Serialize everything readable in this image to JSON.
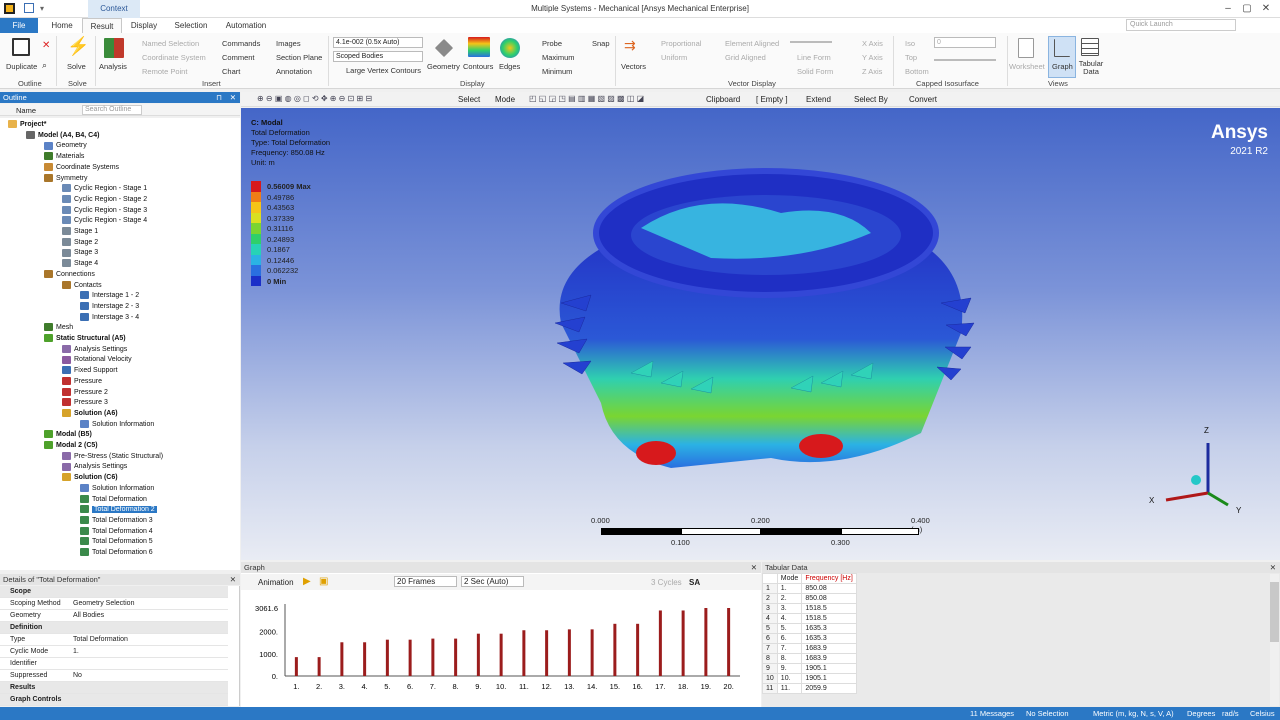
{
  "window": {
    "title": "Multiple Systems - Mechanical [Ansys Mechanical Enterprise]",
    "context_tab": "Context",
    "quick_launch": "Quick Launch"
  },
  "tabs": [
    "File",
    "Home",
    "Result",
    "Display",
    "Selection",
    "Automation"
  ],
  "ribbon": {
    "outline": {
      "duplicate": "Duplicate",
      "group": "Outline"
    },
    "solve": {
      "solve": "Solve",
      "group": "Solve"
    },
    "insert": {
      "analysis": "Analysis",
      "named_selection": "Named Selection",
      "coordinate_system": "Coordinate System",
      "remote_point": "Remote Point",
      "commands": "Commands",
      "comment": "Comment",
      "chart": "Chart",
      "images": "Images",
      "section_plane": "Section Plane",
      "annotation": "Annotation",
      "group": "Insert"
    },
    "display": {
      "scale": "4.1e-002 (0.5x Auto)",
      "scoped": "Scoped Bodies",
      "large_vertex": "Large Vertex Contours",
      "geometry": "Geometry",
      "contours": "Contours",
      "edges": "Edges",
      "probe": "Probe",
      "maximum": "Maximum",
      "minimum": "Minimum",
      "snap": "Snap",
      "group": "Display"
    },
    "vector": {
      "vectors": "Vectors",
      "proportional": "Proportional",
      "uniform": "Uniform",
      "element_aligned": "Element Aligned",
      "grid_aligned": "Grid Aligned",
      "line_form": "Line Form",
      "solid_form": "Solid Form",
      "x_axis": "X Axis",
      "y_axis": "Y Axis",
      "z_axis": "Z Axis",
      "group": "Vector Display"
    },
    "capped": {
      "iso": "Iso",
      "top": "Top",
      "bottom": "Bottom",
      "value": "0",
      "group": "Capped Isosurface"
    },
    "views": {
      "worksheet": "Worksheet",
      "graph": "Graph",
      "tabular": "Tabular Data",
      "group": "Views"
    }
  },
  "toolbar": {
    "select": "Select",
    "mode": "Mode",
    "clipboard": "Clipboard",
    "empty": "[ Empty ]",
    "extend": "Extend",
    "select_by": "Select By",
    "convert": "Convert"
  },
  "outline": {
    "title": "Outline",
    "name_col": "Name",
    "search_placeholder": "Search Outline",
    "nodes": [
      {
        "label": "Project*",
        "bold": true
      },
      {
        "label": "Model (A4, B4, C4)",
        "bold": true
      },
      {
        "label": "Geometry"
      },
      {
        "label": "Materials"
      },
      {
        "label": "Coordinate Systems"
      },
      {
        "label": "Symmetry"
      },
      {
        "label": "Cyclic Region - Stage 1"
      },
      {
        "label": "Cyclic Region - Stage 2"
      },
      {
        "label": "Cyclic Region - Stage 3"
      },
      {
        "label": "Cyclic Region - Stage 4"
      },
      {
        "label": "Stage 1"
      },
      {
        "label": "Stage 2"
      },
      {
        "label": "Stage 3"
      },
      {
        "label": "Stage 4"
      },
      {
        "label": "Connections"
      },
      {
        "label": "Contacts"
      },
      {
        "label": "Interstage 1 - 2"
      },
      {
        "label": "Interstage 2 - 3"
      },
      {
        "label": "Interstage 3 - 4"
      },
      {
        "label": "Mesh"
      },
      {
        "label": "Static Structural (A5)",
        "bold": true
      },
      {
        "label": "Analysis Settings"
      },
      {
        "label": "Rotational Velocity"
      },
      {
        "label": "Fixed Support"
      },
      {
        "label": "Pressure"
      },
      {
        "label": "Pressure 2"
      },
      {
        "label": "Pressure 3"
      },
      {
        "label": "Solution (A6)",
        "bold": true
      },
      {
        "label": "Solution Information"
      },
      {
        "label": "Modal (B5)",
        "bold": true
      },
      {
        "label": "Modal 2 (C5)",
        "bold": true
      },
      {
        "label": "Pre-Stress (Static Structural)"
      },
      {
        "label": "Analysis Settings"
      },
      {
        "label": "Solution (C6)",
        "bold": true
      },
      {
        "label": "Solution Information"
      },
      {
        "label": "Total Deformation"
      },
      {
        "label": "Total Deformation 2"
      },
      {
        "label": "Total Deformation 3"
      },
      {
        "label": "Total Deformation 4"
      },
      {
        "label": "Total Deformation 5"
      },
      {
        "label": "Total Deformation 6"
      }
    ]
  },
  "details": {
    "title": "Details of \"Total Deformation\"",
    "rows": [
      {
        "k": "Scope",
        "v": "",
        "sec": true
      },
      {
        "k": "Scoping Method",
        "v": "Geometry Selection"
      },
      {
        "k": "Geometry",
        "v": "All Bodies"
      },
      {
        "k": "Definition",
        "v": "",
        "sec": true
      },
      {
        "k": "Type",
        "v": "Total Deformation"
      },
      {
        "k": "Cyclic Mode",
        "v": "1."
      },
      {
        "k": "Identifier",
        "v": ""
      },
      {
        "k": "Suppressed",
        "v": "No"
      },
      {
        "k": "Results",
        "v": "",
        "sec": true
      },
      {
        "k": "Graph Controls",
        "v": "",
        "sec": true
      }
    ]
  },
  "viewport": {
    "info": [
      "C: Modal",
      "Total Deformation",
      "Type: Total Deformation",
      "Frequency: 850.08 Hz",
      "Unit: m"
    ],
    "brand": "Ansys",
    "version": "2021 R2",
    "legend": [
      "0.56009 Max",
      "0.49786",
      "0.43563",
      "0.37339",
      "0.31116",
      "0.24893",
      "0.1867",
      "0.12446",
      "0.062232",
      "0 Min"
    ],
    "legend_colors": [
      "#d7191c",
      "#f07d17",
      "#f5c518",
      "#d9e021",
      "#7ad531",
      "#2fd06a",
      "#27d3b6",
      "#2bb2e4",
      "#2a6fe0",
      "#1b2fc8"
    ],
    "scale_top": [
      "0.000",
      "0.200",
      "0.400 (m)"
    ],
    "scale_bottom": [
      "0.100",
      "0.300"
    ],
    "axes": {
      "x": "X",
      "y": "Y",
      "z": "Z"
    }
  },
  "graph": {
    "title": "Graph",
    "animation": "Animation",
    "frames": "20 Frames",
    "duration": "2 Sec (Auto)",
    "cycles": "3 Cycles",
    "sa": "SA",
    "chart_data": {
      "type": "bar",
      "categories": [
        "1.",
        "2.",
        "3.",
        "4.",
        "5.",
        "6.",
        "7.",
        "8.",
        "9.",
        "10.",
        "11.",
        "12.",
        "13.",
        "14.",
        "15.",
        "16.",
        "17.",
        "18.",
        "19.",
        "20."
      ],
      "values": [
        850.08,
        850.08,
        1518.5,
        1518.5,
        1635.3,
        1635.3,
        1683.9,
        1683.9,
        1905.1,
        1905.1,
        2059.9,
        2059.9,
        2100,
        2100,
        2350,
        2350,
        2950,
        2950,
        3061.6,
        3061.6
      ],
      "ytick_labels": [
        "0.",
        "1000.",
        "2000.",
        "3061.6"
      ],
      "ylim": [
        0,
        3061.6
      ],
      "color": "#9b1c1c"
    }
  },
  "tabular": {
    "title": "Tabular Data",
    "col_mode": "Mode",
    "col_freq": "Frequency [Hz]",
    "rows": [
      [
        "1",
        "1.",
        "850.08"
      ],
      [
        "2",
        "2.",
        "850.08"
      ],
      [
        "3",
        "3.",
        "1518.5"
      ],
      [
        "4",
        "4.",
        "1518.5"
      ],
      [
        "5",
        "5.",
        "1635.3"
      ],
      [
        "6",
        "6.",
        "1635.3"
      ],
      [
        "7",
        "7.",
        "1683.9"
      ],
      [
        "8",
        "8.",
        "1683.9"
      ],
      [
        "9",
        "9.",
        "1905.1"
      ],
      [
        "10",
        "10.",
        "1905.1"
      ],
      [
        "11",
        "11.",
        "2059.9"
      ]
    ]
  },
  "status": {
    "messages": "11 Messages",
    "selection": "No Selection",
    "units": "Metric (m, kg, N, s, V, A)",
    "degrees": "Degrees",
    "rad": "rad/s",
    "celsius": "Celsius"
  }
}
